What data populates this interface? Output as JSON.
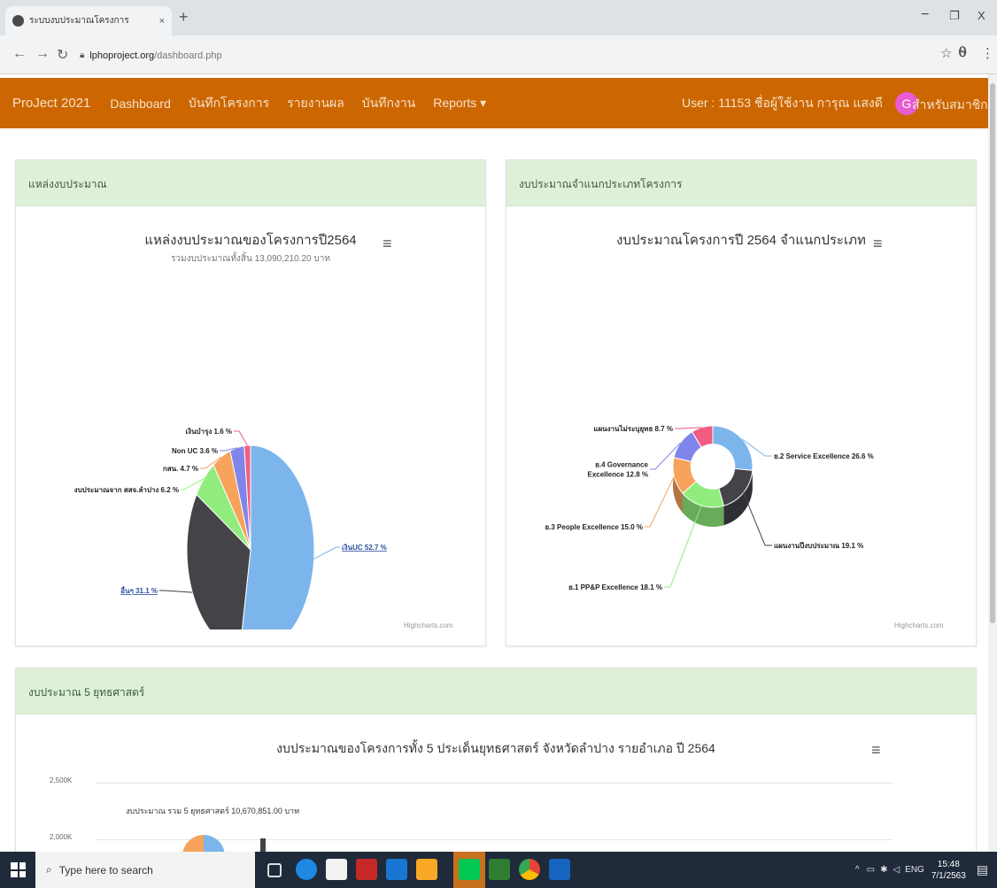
{
  "browser": {
    "tab_title": "ระบบงบประมาณโครงการ",
    "tab_close": "×",
    "new_tab": "+",
    "url_host": "lphoproject.org",
    "url_path": "/dashboard.php",
    "win_min": "−",
    "win_max": "❐",
    "win_close": "X"
  },
  "navbar": {
    "brand": "ProJect 2021",
    "links": [
      "Dashboard",
      "บันทึกโครงการ",
      "รายงานผล",
      "บันทึกงาน",
      "Reports ▾"
    ],
    "user_label": "User : 11153 ชื่อผู้ใช้งาน การุณ แสงดี",
    "avatar_letter": "G",
    "profile_label": "สำหรับสมาชิก ▾"
  },
  "panels": {
    "source": {
      "header": "แหล่งงบประมาณ",
      "title": "แหล่งงบประมาณของโครงการปี2564",
      "subtitle": "รวมงบประมาณทั้งสิ้น 13,090,210.20 บาท",
      "credits": "Highcharts.com"
    },
    "category": {
      "header": "งบประมาณจำแนกประเภทโครงการ",
      "title": "งบประมาณโครงการปี 2564 จำแนกประเภท",
      "credits": "Highcharts.com"
    },
    "strategy": {
      "header": "งบประมาณ 5 ยุทธศาสตร์",
      "title": "งบประมาณของโครงการทั้ง 5 ประเด็นยุทธศาสตร์ จังหวัดลำปาง รายอำเภอ ปี 2564",
      "subtitle": "งบประมาณ รวม 5 ยุทธศาสตร์ 10,670,851.00 บาท",
      "y_ticks": [
        "2,500K",
        "2,000K"
      ]
    }
  },
  "chart_data": [
    {
      "type": "pie",
      "title": "แหล่งงบประมาณของโครงการปี2564",
      "subtitle": "รวมงบประมาณทั้งสิ้น 13,090,210.20 บาท",
      "slices": [
        {
          "label": "เงินUC 52.7 %",
          "value": 52.7,
          "color": "#7cb5ec"
        },
        {
          "label": "อื่นๆ 31.1 %",
          "value": 31.1,
          "color": "#434348"
        },
        {
          "label": "งบประมาณจาก สสจ.ลำปาง 6.2 %",
          "value": 6.2,
          "color": "#90ed7d"
        },
        {
          "label": "กสน. 4.7 %",
          "value": 4.7,
          "color": "#f7a35c"
        },
        {
          "label": "Non UC 3.6 %",
          "value": 3.6,
          "color": "#8085e9"
        },
        {
          "label": "เงินบำรุง 1.6 %",
          "value": 1.6,
          "color": "#f15c80"
        }
      ]
    },
    {
      "type": "pie",
      "title": "งบประมาณโครงการปี 2564 จำแนกประเภท",
      "slices": [
        {
          "label": "ย.2 Service Excellence 26.6 %",
          "value": 26.6,
          "color": "#7cb5ec"
        },
        {
          "label": "แผนงานปีงบประมาณ 19.1 %",
          "value": 19.1,
          "color": "#434348"
        },
        {
          "label": "ย.1 PP&P Excellence 18.1 %",
          "value": 18.1,
          "color": "#90ed7d"
        },
        {
          "label": "ย.3 People Excellence 15.0 %",
          "value": 15.0,
          "color": "#f7a35c"
        },
        {
          "label": "ย.4 Governance Excellence 12.8 %",
          "value": 12.8,
          "color": "#8085e9"
        },
        {
          "label": "แผนงานไม่ระบุยุทธ 8.7 %",
          "value": 8.7,
          "color": "#f15c80"
        }
      ]
    }
  ],
  "taskbar": {
    "search_placeholder": "Type here to search",
    "tray_lang": "ENG",
    "time": "15:48",
    "date": "7/1/2563"
  }
}
